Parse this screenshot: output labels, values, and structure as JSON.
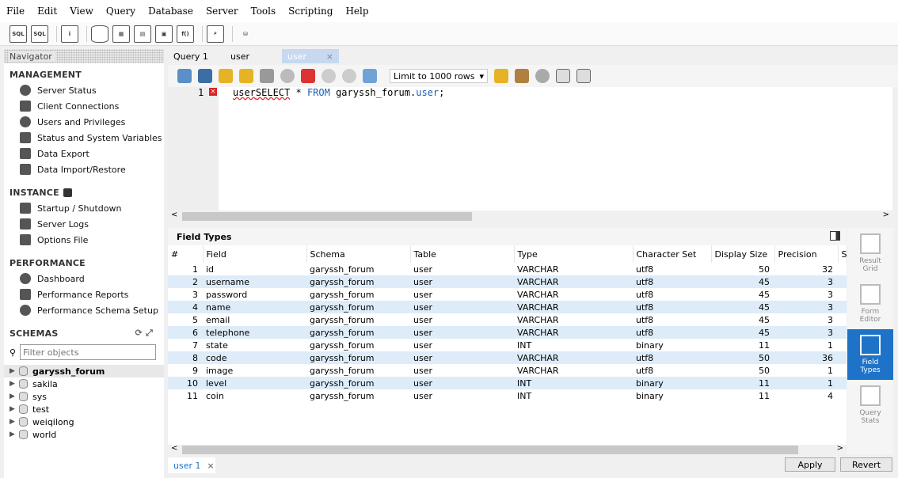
{
  "menu": [
    "File",
    "Edit",
    "View",
    "Query",
    "Database",
    "Server",
    "Tools",
    "Scripting",
    "Help"
  ],
  "toolbar_icons": [
    "new-sql-tab-icon",
    "open-sql-script-icon",
    "inspector-icon",
    "create-schema-icon",
    "create-table-icon",
    "create-view-icon",
    "create-procedure-icon",
    "create-function-icon",
    "search-table-data-icon",
    "reconnect-icon"
  ],
  "navigator": {
    "title": "Navigator",
    "management": {
      "title": "MANAGEMENT",
      "items": [
        "Server Status",
        "Client Connections",
        "Users and Privileges",
        "Status and System Variables",
        "Data Export",
        "Data Import/Restore"
      ]
    },
    "instance": {
      "title": "INSTANCE",
      "items": [
        "Startup / Shutdown",
        "Server Logs",
        "Options File"
      ]
    },
    "performance": {
      "title": "PERFORMANCE",
      "items": [
        "Dashboard",
        "Performance Reports",
        "Performance Schema Setup"
      ]
    },
    "schemas": {
      "title": "SCHEMAS",
      "filter_placeholder": "Filter objects",
      "items": [
        "garyssh_forum",
        "sakila",
        "sys",
        "test",
        "weiqilong",
        "world"
      ]
    }
  },
  "tabs": [
    "Query 1",
    "user",
    "user"
  ],
  "editor_toolbar": {
    "limit": "Limit to 1000 rows"
  },
  "editor": {
    "line_number": "1",
    "code_err": "user",
    "code_kw1": "SELECT",
    "code_mid": " * ",
    "code_kw2": "FROM",
    "code_schema": " garyssh_forum.",
    "code_table": "user",
    "code_end": ";"
  },
  "results": {
    "title": "Field Types",
    "columns": [
      "#",
      "Field",
      "Schema",
      "Table",
      "Type",
      "Character Set",
      "Display Size",
      "Precision",
      "S"
    ],
    "rows": [
      [
        "1",
        "id",
        "garyssh_forum",
        "user",
        "VARCHAR",
        "utf8",
        "50",
        "32"
      ],
      [
        "2",
        "username",
        "garyssh_forum",
        "user",
        "VARCHAR",
        "utf8",
        "45",
        "3"
      ],
      [
        "3",
        "password",
        "garyssh_forum",
        "user",
        "VARCHAR",
        "utf8",
        "45",
        "3"
      ],
      [
        "4",
        "name",
        "garyssh_forum",
        "user",
        "VARCHAR",
        "utf8",
        "45",
        "3"
      ],
      [
        "5",
        "email",
        "garyssh_forum",
        "user",
        "VARCHAR",
        "utf8",
        "45",
        "3"
      ],
      [
        "6",
        "telephone",
        "garyssh_forum",
        "user",
        "VARCHAR",
        "utf8",
        "45",
        "3"
      ],
      [
        "7",
        "state",
        "garyssh_forum",
        "user",
        "INT",
        "binary",
        "11",
        "1"
      ],
      [
        "8",
        "code",
        "garyssh_forum",
        "user",
        "VARCHAR",
        "utf8",
        "50",
        "36"
      ],
      [
        "9",
        "image",
        "garyssh_forum",
        "user",
        "VARCHAR",
        "utf8",
        "50",
        "1"
      ],
      [
        "10",
        "level",
        "garyssh_forum",
        "user",
        "INT",
        "binary",
        "11",
        "1"
      ],
      [
        "11",
        "coin",
        "garyssh_forum",
        "user",
        "INT",
        "binary",
        "11",
        "4"
      ]
    ]
  },
  "side_panel": {
    "result_grid": "Result Grid",
    "form_editor": "Form Editor",
    "field_types": "Field Types",
    "query_stats": "Query Stats"
  },
  "bottom": {
    "tab": "user 1",
    "apply": "Apply",
    "revert": "Revert"
  }
}
